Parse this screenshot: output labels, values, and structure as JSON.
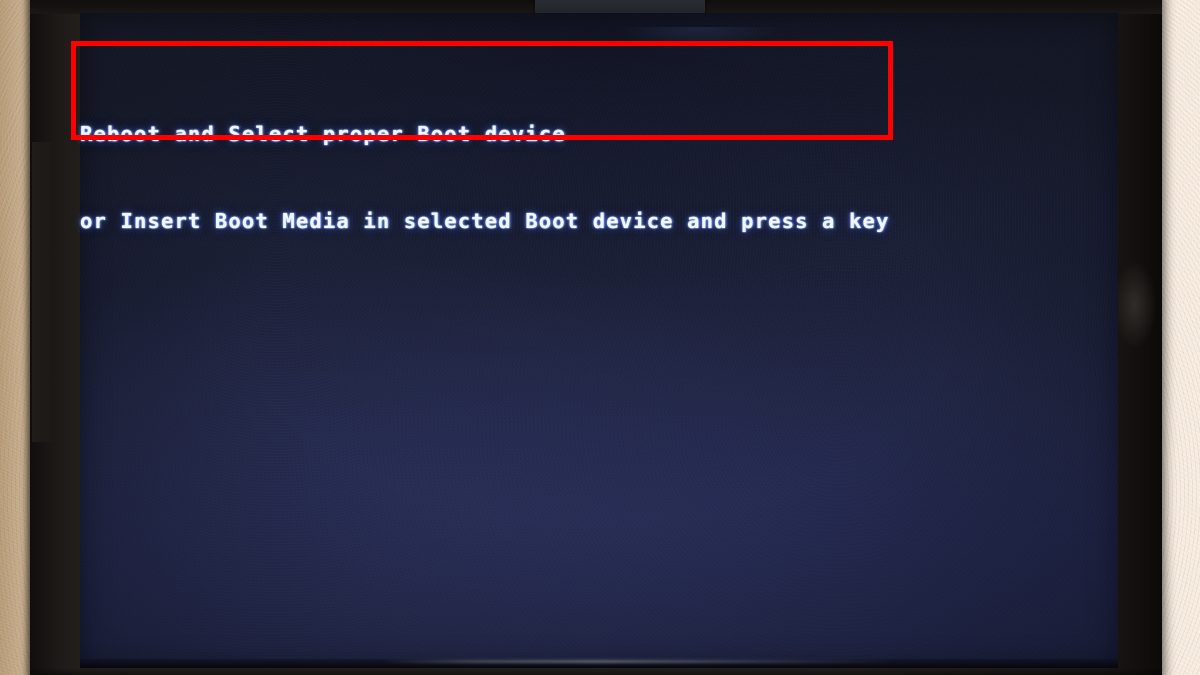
{
  "scene": {
    "subject": "computer-monitor-photograph",
    "wall": {
      "name": "textured-beige-wall",
      "color_left": "#dfc39c",
      "color_right": "#f7ece0"
    },
    "monitor": {
      "name": "lcd-monitor",
      "bezel_color": "#221f1b",
      "webcam_label": "webcam-clip"
    }
  },
  "screen": {
    "name": "bios-boot-error-screen",
    "background_color": "#1e2236",
    "background_color_bottom": "#232a52",
    "text_color": "#f2f6ff",
    "glow_color": "#5a82f0",
    "message_lines": [
      "Reboot and Select proper Boot device",
      "or Insert Boot Media in selected Boot device and press a key"
    ]
  },
  "annotation": {
    "name": "red-highlight-rectangle",
    "color": "#fe0000",
    "stroke_width": "5px",
    "shape": "rectangle"
  }
}
